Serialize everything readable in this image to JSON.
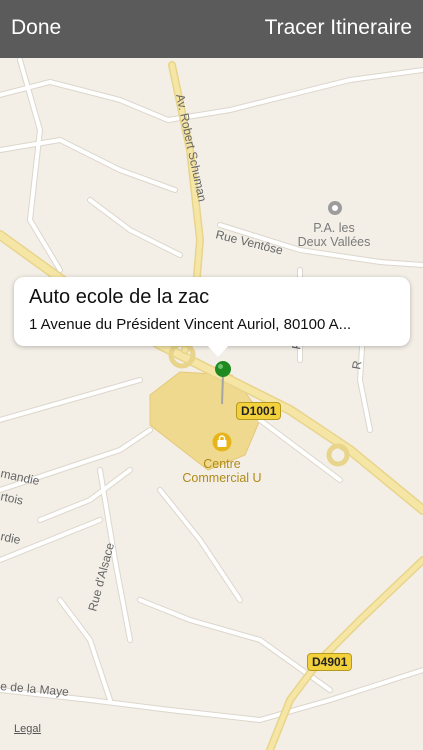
{
  "topbar": {
    "done_label": "Done",
    "route_label": "Tracer Itineraire"
  },
  "callout": {
    "title": "Auto ecole de la zac",
    "subtitle": "1 Avenue du Président Vincent Auriol, 80100 A..."
  },
  "map": {
    "street_labels": {
      "robert_schuman": "Av. Robert Schuman",
      "ventose": "Rue Ventôse",
      "r_vertical": "R",
      "r_vertical_2": "R",
      "alsace": "Rue d'Alsace",
      "maye": "e de la Maye",
      "mandie": "mandie",
      "rtois": "rtois",
      "rdie": "rdie"
    },
    "poi_labels": {
      "pa_line1": "P.A. les",
      "pa_line2": "Deux Vallées",
      "centre_line1": "Centre",
      "centre_line2": "Commercial U"
    },
    "road_shields": {
      "d1001": "D1001",
      "d4901": "D4901"
    },
    "legal_label": "Legal",
    "colors": {
      "land": "#f3efe7",
      "road": "#ffffff",
      "road_edge": "#dcd6cb",
      "highway": "#f6e6a6",
      "commercial": "#efd98f",
      "pin": "#1f8a1f"
    }
  }
}
